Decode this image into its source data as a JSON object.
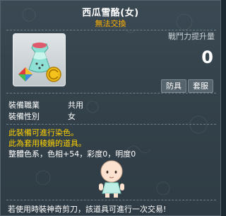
{
  "item": {
    "name": "西瓜雪酪(女)",
    "trade_status": "無法交換",
    "combat_power_label": "戰鬥力提升量",
    "combat_power_value": "0",
    "tags": [
      "防具",
      "套服"
    ]
  },
  "info": [
    {
      "label": "裝備職業",
      "value": "共用"
    },
    {
      "label": "裝備性別",
      "value": "女"
    }
  ],
  "notices": [
    "此裝備可進行染色。",
    "此為套用稜鏡的道具。"
  ],
  "dye_info": "整體色系，色相+54，彩度0，明度0",
  "footer": "若使用時裝神奇剪刀，該道具可進行一次交易!",
  "colors": {
    "title": "#ffffff",
    "subtitle": "#ffb000",
    "notice": "#ffd200",
    "background": "#34424b"
  },
  "icons": {
    "item": "melon-sorbet-icon",
    "prism": "prism-badge-icon",
    "cash": "cash-coin-icon",
    "preview": "character-preview"
  }
}
